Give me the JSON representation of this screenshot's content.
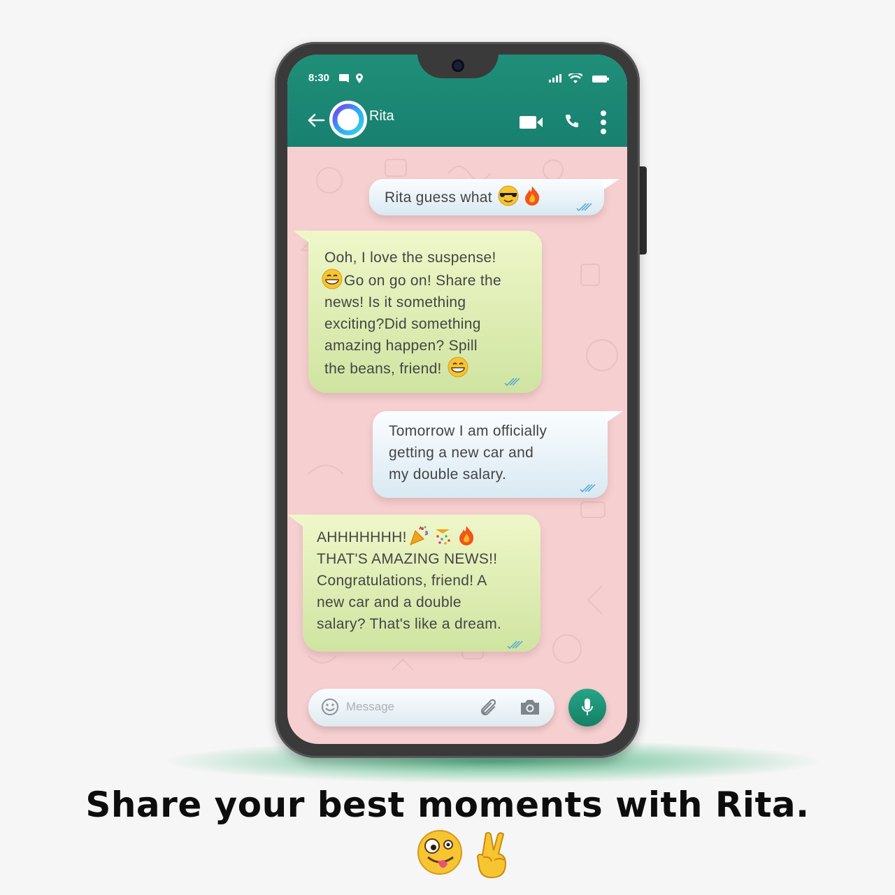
{
  "status_bar": {
    "time": "8:30"
  },
  "header": {
    "contact_name": "Rita",
    "icons": [
      "back-arrow-icon",
      "video-call-icon",
      "phone-call-icon",
      "more-options-icon"
    ]
  },
  "messages": [
    {
      "direction": "outgoing",
      "lines": [
        "Rita guess what"
      ],
      "trailing_emojis": [
        "smiling-face-with-sunglasses",
        "fire"
      ]
    },
    {
      "direction": "incoming",
      "lines": [
        "Ooh, I love the suspense!",
        "Go on go on! Share the",
        "news! Is it something",
        "exciting?Did something",
        "amazing happen? Spill",
        "the beans, friend!"
      ],
      "emojis": [
        "grinning-face-with-smiling-eyes",
        "grinning-face-with-smiling-eyes"
      ]
    },
    {
      "direction": "outgoing",
      "lines": [
        "Tomorrow I am officially",
        "getting a new car and",
        "my double salary."
      ]
    },
    {
      "direction": "incoming",
      "lines": [
        "AHHHHHHH!",
        "THAT'S AMAZING NEWS!!",
        "Congratulations, friend! A",
        "new car and a double",
        "salary? That's like a dream."
      ],
      "trailing_emojis": [
        "party-popper",
        "confetti-ball",
        "fire"
      ]
    }
  ],
  "composer": {
    "placeholder": "Message"
  },
  "caption": {
    "text": "Share your best moments with Rita.",
    "emojis": [
      "zany-face",
      "victory-hand"
    ]
  },
  "colors": {
    "app_bar": "#1f8f78",
    "chat_background": "#f6cfd0",
    "outgoing_bubble": "#e6f1f7",
    "incoming_bubble": "#dfeeb4",
    "mic_button": "#1b947a",
    "read_ticks": "#4aa3d8"
  }
}
